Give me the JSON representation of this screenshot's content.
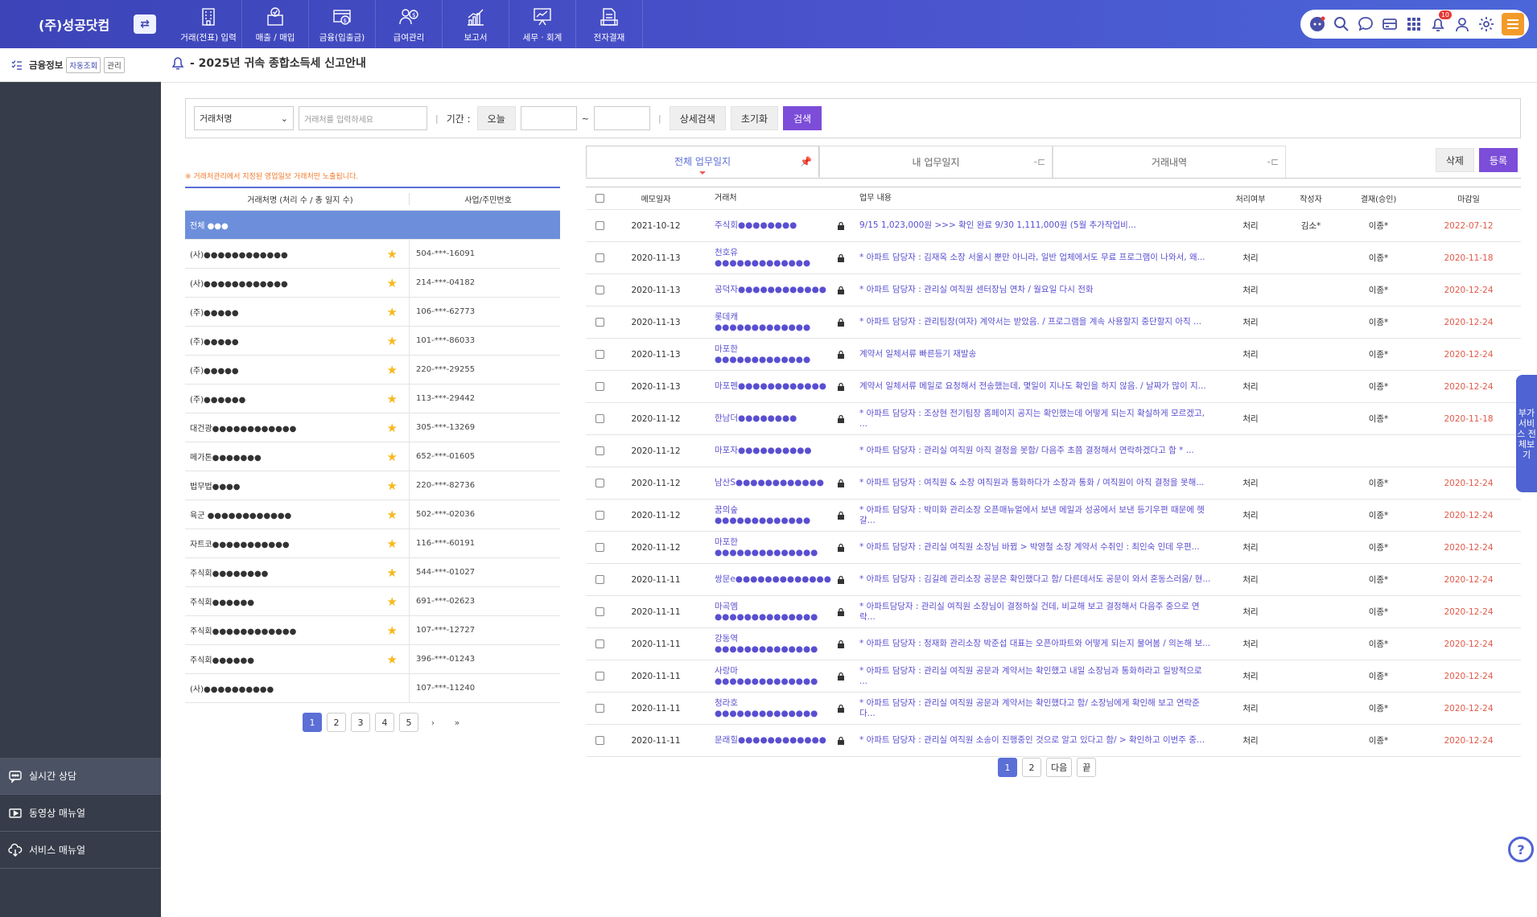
{
  "brand": {
    "name": "(주)성공닷컴",
    "switch_icon": "swap-icon"
  },
  "nav": [
    {
      "label": "거래(전표) 입력",
      "icon": "building-icon"
    },
    {
      "label": "매출 / 매입",
      "icon": "card-check-icon"
    },
    {
      "label": "금융(입출금)",
      "icon": "bank-card-icon"
    },
    {
      "label": "급여관리",
      "icon": "payroll-icon"
    },
    {
      "label": "보고서",
      "icon": "chart-icon"
    },
    {
      "label": "세무 · 회계",
      "icon": "presentation-icon"
    },
    {
      "label": "전자결재",
      "icon": "approval-icon"
    }
  ],
  "topright": {
    "badge_count": "10",
    "icons": [
      "chatbot-icon",
      "search-icon",
      "chat-icon",
      "message-icon",
      "wallet-icon",
      "grid-icon",
      "bell-icon",
      "user-icon",
      "gear-icon",
      "menu-icon"
    ]
  },
  "sidebar": {
    "title": "금융정보",
    "tag1": "자동조회",
    "tag2": "관리",
    "bottom": [
      {
        "label": "실시간 상담"
      },
      {
        "label": "동영상 매뉴얼"
      },
      {
        "label": "서비스 매뉴얼"
      }
    ]
  },
  "notice": {
    "text": "- 2025년 귀속 종합소득세 신고안내"
  },
  "search": {
    "select_value": "거래처명",
    "placeholder": "거래처를 입력하세요",
    "period_label": "기간 :",
    "today": "오늘",
    "tilde": "~",
    "detail": "상세검색",
    "reset": "초기화",
    "submit": "검색"
  },
  "left": {
    "note": "※ 거래처관리에서 지정된 영업일보 거래처만 노출됩니다.",
    "headers": [
      "거래처명 (처리 수 / 총 일지 수)",
      "사업/주민번호"
    ],
    "rows": [
      {
        "name": "전체 ●●●",
        "no": "",
        "selected": true,
        "star": false
      },
      {
        "name": "(사)●●●●●●●●●●●●",
        "no": "504-***-16091",
        "star": true
      },
      {
        "name": "(사)●●●●●●●●●●●●",
        "no": "214-***-04182",
        "star": true
      },
      {
        "name": "(주)●●●●●",
        "no": "106-***-62773",
        "star": true
      },
      {
        "name": "(주)●●●●●",
        "no": "101-***-86033",
        "star": true
      },
      {
        "name": "(주)●●●●●",
        "no": "220-***-29255",
        "star": true
      },
      {
        "name": "(주)●●●●●●",
        "no": "113-***-29442",
        "star": true
      },
      {
        "name": "대건광●●●●●●●●●●●●",
        "no": "305-***-13269",
        "star": true
      },
      {
        "name": "메가톤●●●●●●●",
        "no": "652-***-01605",
        "star": true
      },
      {
        "name": "법무법●●●●",
        "no": "220-***-82736",
        "star": true
      },
      {
        "name": "육군 ●●●●●●●●●●●●",
        "no": "502-***-02036",
        "star": true
      },
      {
        "name": "자트코●●●●●●●●●●●",
        "no": "116-***-60191",
        "star": true
      },
      {
        "name": "주식회●●●●●●●●",
        "no": "544-***-01027",
        "star": true
      },
      {
        "name": "주식회●●●●●●",
        "no": "691-***-02623",
        "star": true
      },
      {
        "name": "주식회●●●●●●●●●●●●",
        "no": "107-***-12727",
        "star": true
      },
      {
        "name": "주식회●●●●●●",
        "no": "396-***-01243",
        "star": true
      },
      {
        "name": "(사)●●●●●●●●●●",
        "no": "107-***-11240",
        "star": false
      }
    ],
    "pages": [
      "1",
      "2",
      "3",
      "4",
      "5"
    ],
    "next": "›",
    "last": "»"
  },
  "tabs": [
    {
      "label": "전체 업무일지",
      "pin": "📌"
    },
    {
      "label": "내 업무일지",
      "pin": "-⊏"
    },
    {
      "label": "거래내역",
      "pin": "-⊏"
    }
  ],
  "actions": {
    "delete": "삭제",
    "register": "등록"
  },
  "right": {
    "headers": [
      "메모일자",
      "거래처",
      "업무 내용",
      "처리여부",
      "작성자",
      "결재(승인)",
      "마감일"
    ],
    "rows": [
      {
        "date": "2021-10-12",
        "co": "주식회●●●●●●●●",
        "work": "9/15 1,023,000원 >>> 확인 완료 9/30 1,111,000원 (5월 추가작업비...",
        "done": "처리",
        "author": "김소*",
        "appr": "이종*",
        "due": "2022-07-12",
        "lock": true
      },
      {
        "date": "2020-11-13",
        "co": "천호유●●●●●●●●●●●●●",
        "work": "* 아파트 담당자 : 김재옥 소장 서울시 뿐만 아니라, 일반 업체에서도 무료 프로그램이 나와서, 왜...",
        "done": "처리",
        "author": "",
        "appr": "이종*",
        "due": "2020-11-18",
        "lock": true
      },
      {
        "date": "2020-11-13",
        "co": "공덕자●●●●●●●●●●●●",
        "work": "* 아파트 담당자 : 관리실 여직원 센터장님 연차 / 월요일 다시 전화",
        "done": "처리",
        "author": "",
        "appr": "이종*",
        "due": "2020-12-24",
        "lock": true
      },
      {
        "date": "2020-11-13",
        "co": "롯데캐●●●●●●●●●●●●●",
        "work": "* 아파트 담당자 : 관리팀장(여자) 계약서는 받았음. / 프로그램을 계속 사용할지 중단할지 아직 ...",
        "done": "처리",
        "author": "",
        "appr": "이종*",
        "due": "2020-12-24",
        "lock": true
      },
      {
        "date": "2020-11-13",
        "co": "마포한●●●●●●●●●●●●●",
        "work": "계약서 일체서류 빠른등기 재발송",
        "done": "처리",
        "author": "",
        "appr": "이종*",
        "due": "2020-12-24",
        "lock": true
      },
      {
        "date": "2020-11-13",
        "co": "마포펜●●●●●●●●●●●●",
        "work": "계약서 일체서류 메일로 요청해서 전송했는데, 몇일이 지나도 확인을 하지 않음. / 날짜가 많이 지...",
        "done": "처리",
        "author": "",
        "appr": "이종*",
        "due": "2020-12-24",
        "lock": true
      },
      {
        "date": "2020-11-12",
        "co": "한남더●●●●●●●●",
        "work": "* 아파트 담당자 : 조상현 전기팀장 홈페이지 공지는 확인했는데 어떻게 되는지 확실하게 모르겠고, ...",
        "done": "처리",
        "author": "",
        "appr": "이종*",
        "due": "2020-11-18",
        "lock": true
      },
      {
        "date": "2020-11-12",
        "co": "마포자●●●●●●●●●●",
        "work": "* 아파트 담당자 : 관리실 여직원 아직 결정을 못함/ 다음주 초쯤 결정해서 연락하겠다고 함 * ...",
        "done": "",
        "author": "",
        "appr": "",
        "due": "",
        "lock": false
      },
      {
        "date": "2020-11-12",
        "co": "남산S●●●●●●●●●●●●",
        "work": "* 아파트 담당자 : 여직원 & 소장 여직원과 통화하다가 소장과 통화 / 여직원이 아직 결정을 못해...",
        "done": "처리",
        "author": "",
        "appr": "이종*",
        "due": "2020-12-24",
        "lock": true
      },
      {
        "date": "2020-11-12",
        "co": "꿈의숲●●●●●●●●●●●●●",
        "work": "* 아파트 담당자 : 박미화 관리소장 오픈매뉴얼에서 보낸 메일과 성공에서 보낸 등기우편 때문에 헷갈...",
        "done": "처리",
        "author": "",
        "appr": "이종*",
        "due": "2020-12-24",
        "lock": true
      },
      {
        "date": "2020-11-12",
        "co": "마포한●●●●●●●●●●●●●●",
        "work": "* 아파트 담당자 : 관리실 여직원 소장님 바뀜 > 박영철 소장 계약서 수취인 : 최인숙 인데 우편...",
        "done": "처리",
        "author": "",
        "appr": "이종*",
        "due": "2020-12-24",
        "lock": true
      },
      {
        "date": "2020-11-11",
        "co": "쌍문e●●●●●●●●●●●●●",
        "work": "* 아파트 담당자 : 김길례 관리소장 공문은 확인했다고 함/ 다른데서도 공문이 와서 혼동스러움/ 현...",
        "done": "처리",
        "author": "",
        "appr": "이종*",
        "due": "2020-12-24",
        "lock": true
      },
      {
        "date": "2020-11-11",
        "co": "마곡엠●●●●●●●●●●●●●●",
        "work": "* 아파트담당자 : 관리실 여직원 소장님이 결정하실 건데, 비교해 보고 결정해서 다음주 중으로 연락...",
        "done": "처리",
        "author": "",
        "appr": "이종*",
        "due": "2020-12-24",
        "lock": true
      },
      {
        "date": "2020-11-11",
        "co": "강동역●●●●●●●●●●●●●●",
        "work": "* 아파트 담당자 : 정재화 관리소장 박준섭 대표는 오픈아파트와 어떻게 되는지 물어봄 / 의논해 보...",
        "done": "처리",
        "author": "",
        "appr": "이종*",
        "due": "2020-12-24",
        "lock": true
      },
      {
        "date": "2020-11-11",
        "co": "사랑마●●●●●●●●●●●●●●",
        "work": "* 아파트 담당자 : 관리실 여직원 공문과 계약서는 확인했고 내일 소장님과 통화하라고 일방적으로 ...",
        "done": "처리",
        "author": "",
        "appr": "이종*",
        "due": "2020-12-24",
        "lock": true
      },
      {
        "date": "2020-11-11",
        "co": "청라호●●●●●●●●●●●●●●",
        "work": "* 아파트 담당자 : 관리실 여직원 공문과 계약서는 확인했다고 함/ 소장님에게 확인해 보고 연락준다...",
        "done": "처리",
        "author": "",
        "appr": "이종*",
        "due": "2020-12-24",
        "lock": true
      },
      {
        "date": "2020-11-11",
        "co": "문래힐●●●●●●●●●●●●",
        "work": "* 아파트 담당자 : 관리실 여직원 소송이 진행중인 것으로 알고 있다고 함/ > 확인하고 이번주 중...",
        "done": "처리",
        "author": "",
        "appr": "이종*",
        "due": "2020-12-24",
        "lock": true
      }
    ],
    "pages": [
      "1",
      "2"
    ],
    "next": "다음",
    "last": "끝"
  },
  "float": {
    "text": "부가서비스 전체보기"
  },
  "help": {
    "text": "?"
  }
}
